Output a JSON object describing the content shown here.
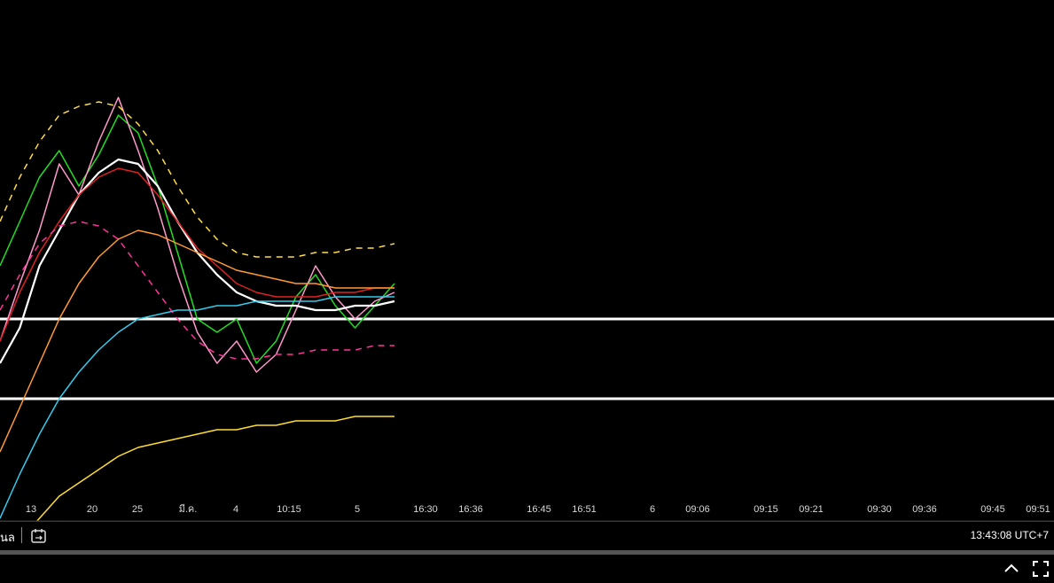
{
  "chart_data": {
    "type": "line",
    "xlabel": "",
    "ylabel": "",
    "grid": false,
    "legend": "none",
    "x_tick_labels": [
      "13",
      "20",
      "25",
      "มี.ค.",
      "4",
      "10:15",
      "5",
      "16:30",
      "16:36",
      "16:45",
      "16:51",
      "6",
      "09:06",
      "09:15",
      "09:21",
      "09:30",
      "09:36",
      "09:45",
      "09:51"
    ],
    "x": [
      0,
      1,
      2,
      3,
      4,
      5,
      6,
      7,
      8,
      9,
      10,
      11,
      12,
      13,
      14,
      15,
      16,
      17,
      18,
      19,
      20
    ],
    "ylim": [
      0,
      100
    ],
    "series": [
      {
        "color": "#22dd22",
        "style": "solid",
        "values": [
          52,
          62,
          72,
          78,
          70,
          77,
          86,
          82,
          70,
          55,
          40,
          37,
          40,
          30,
          35,
          45,
          50,
          43,
          38,
          43,
          48
        ]
      },
      {
        "color": "#ff99cc",
        "style": "solid",
        "values": [
          35,
          48,
          60,
          75,
          68,
          80,
          90,
          78,
          65,
          50,
          37,
          30,
          35,
          28,
          32,
          42,
          52,
          45,
          40,
          44,
          46
        ]
      },
      {
        "color": "#ffffff",
        "style": "solid",
        "values": [
          30,
          38,
          52,
          60,
          68,
          73,
          76,
          75,
          70,
          62,
          55,
          50,
          46,
          44,
          43,
          43,
          42,
          42,
          43,
          43,
          44
        ]
      },
      {
        "color": "#dd2222",
        "style": "solid",
        "values": [
          35,
          46,
          55,
          62,
          68,
          72,
          74,
          73,
          68,
          62,
          56,
          52,
          48,
          46,
          45,
          45,
          45,
          46,
          46,
          47,
          47
        ]
      },
      {
        "color": "#ffdd44",
        "style": "dashed",
        "values": [
          62,
          72,
          80,
          86,
          88,
          89,
          88,
          84,
          78,
          70,
          63,
          58,
          55,
          54,
          54,
          54,
          55,
          55,
          56,
          56,
          57
        ]
      },
      {
        "color": "#ff3399",
        "style": "dashed",
        "values": [
          42,
          50,
          57,
          61,
          62,
          61,
          58,
          52,
          46,
          40,
          35,
          32,
          31,
          31,
          32,
          32,
          33,
          33,
          33,
          34,
          34
        ]
      },
      {
        "color": "#ff9933",
        "style": "solid",
        "values": [
          10,
          20,
          30,
          40,
          48,
          54,
          58,
          60,
          59,
          57,
          55,
          53,
          51,
          50,
          49,
          48,
          48,
          47,
          47,
          47,
          47
        ]
      },
      {
        "color": "#33ccee",
        "style": "solid",
        "values": [
          -5,
          5,
          14,
          22,
          28,
          33,
          37,
          40,
          41,
          42,
          42,
          43,
          43,
          44,
          44,
          44,
          44,
          45,
          45,
          45,
          45
        ]
      },
      {
        "color": "#ffdd33",
        "style": "solid",
        "values": [
          -15,
          -10,
          -5,
          0,
          3,
          6,
          9,
          11,
          12,
          13,
          14,
          15,
          15,
          16,
          16,
          17,
          17,
          17,
          18,
          18,
          18
        ]
      }
    ],
    "horizontal_lines": [
      {
        "color": "#ffffff",
        "value": 40
      },
      {
        "color": "#ffffff",
        "value": 22
      }
    ]
  },
  "bottom_bar": {
    "range_label": "นล",
    "goto_icon": "calendar-arrow-icon",
    "clock": "13:43:08 UTC+7"
  },
  "panel": {
    "collapse_icon": "chevron-up-icon",
    "maximize_icon": "maximize-icon"
  }
}
